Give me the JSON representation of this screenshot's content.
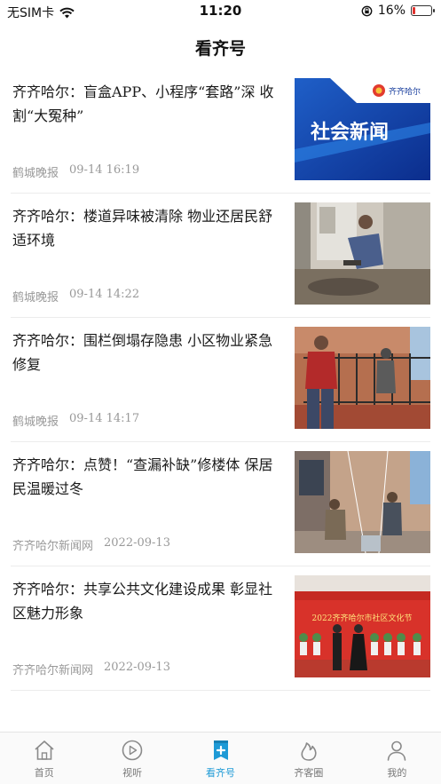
{
  "status_bar": {
    "carrier": "无SIM卡",
    "time": "11:20",
    "battery_percent": "16%",
    "battery_level": 0.16
  },
  "header": {
    "title": "看齐号"
  },
  "news": [
    {
      "title": "齐齐哈尔：盲盒APP、小程序“套路”深 收割“大冤种”",
      "source": "鹤城晚报",
      "date": "09-14 16:19",
      "thumb_text": "社会新闻",
      "thumb_logo": "齐齐哈尔"
    },
    {
      "title": "齐齐哈尔：楼道异味被清除 物业还居民舒适环境",
      "source": "鹤城晚报",
      "date": "09-14 14:22"
    },
    {
      "title": "齐齐哈尔：围栏倒塌存隐患 小区物业紧急修复",
      "source": "鹤城晚报",
      "date": "09-14 14:17"
    },
    {
      "title": "齐齐哈尔：点赞！“查漏补缺”修楼体 保居民温暖过冬",
      "source": "齐齐哈尔新闻网",
      "date": "2022-09-13"
    },
    {
      "title": "齐齐哈尔：共享公共文化建设成果 彰显社区魅力形象",
      "source": "齐齐哈尔新闻网",
      "date": "2022-09-13",
      "thumb_text": "2022齐齐哈尔市社区文化节"
    }
  ],
  "tabs": [
    {
      "label": "首页",
      "icon": "home-icon"
    },
    {
      "label": "视听",
      "icon": "play-icon"
    },
    {
      "label": "看齐号",
      "icon": "add-doc-icon",
      "active": true
    },
    {
      "label": "齐客圈",
      "icon": "flame-icon"
    },
    {
      "label": "我的",
      "icon": "user-icon"
    }
  ],
  "colors": {
    "accent": "#1e9ad6",
    "inactive": "#777777"
  }
}
